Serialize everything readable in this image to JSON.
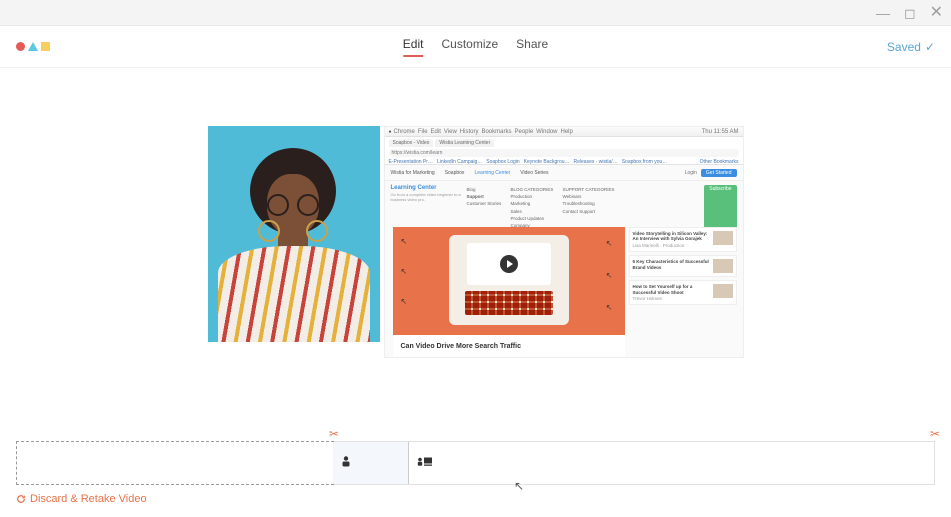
{
  "tabs": {
    "edit": "Edit",
    "customize": "Customize",
    "share": "Share"
  },
  "status": {
    "saved": "Saved"
  },
  "discard": "Discard & Retake Video",
  "screen": {
    "mac_menu": [
      "Chrome",
      "File",
      "Edit",
      "View",
      "History",
      "Bookmarks",
      "People",
      "Window",
      "Help"
    ],
    "mac_time": "Thu 11:55 AM",
    "browser_tabs": [
      "Soapbox - Video",
      "Wistia Learning Center"
    ],
    "address": "https://wistia.com/learn",
    "bookmarks": [
      "E-Presentation Pr…",
      "LinkedIn Campaig…",
      "Soapbox Login",
      "Keynote Backgrou…",
      "Releases · wistia/…",
      "Soapbox from you…",
      "Other Bookmarks"
    ],
    "nav_items": [
      "Wistia for Marketing",
      "Soapbox",
      "Learning Center",
      "Video Series"
    ],
    "nav_cta": "Get Started",
    "login": "Login",
    "lc_title": "Learning Center",
    "lc_sub": "Go from a complete video beginner to a business video pro.",
    "menu_col1": [
      "Blog",
      "Support",
      "Customer Stories"
    ],
    "menu_col2_label": "BLOG CATEGORIES",
    "menu_col2": [
      "Production",
      "Marketing",
      "Sales",
      "Product Updates",
      "Company"
    ],
    "menu_col3_label": "SUPPORT CATEGORIES",
    "menu_col3": [
      "Webinars",
      "Troubleshooting",
      "Contact Support"
    ],
    "subscribe": "Subscribe",
    "hero_title": "Can Video Drive More Search Traffic",
    "cards": [
      {
        "title": "Video Storytelling in Silicon Valley: An Interview with Sylvia Gorajek",
        "sub": "Lisa Marinelli · Production"
      },
      {
        "title": "5 Key Characteristics of Successful Brand Videos",
        "sub": ""
      },
      {
        "title": "How to Set Yourself up for a Successful Video Shoot",
        "sub": "Trevor Holmes"
      }
    ]
  }
}
